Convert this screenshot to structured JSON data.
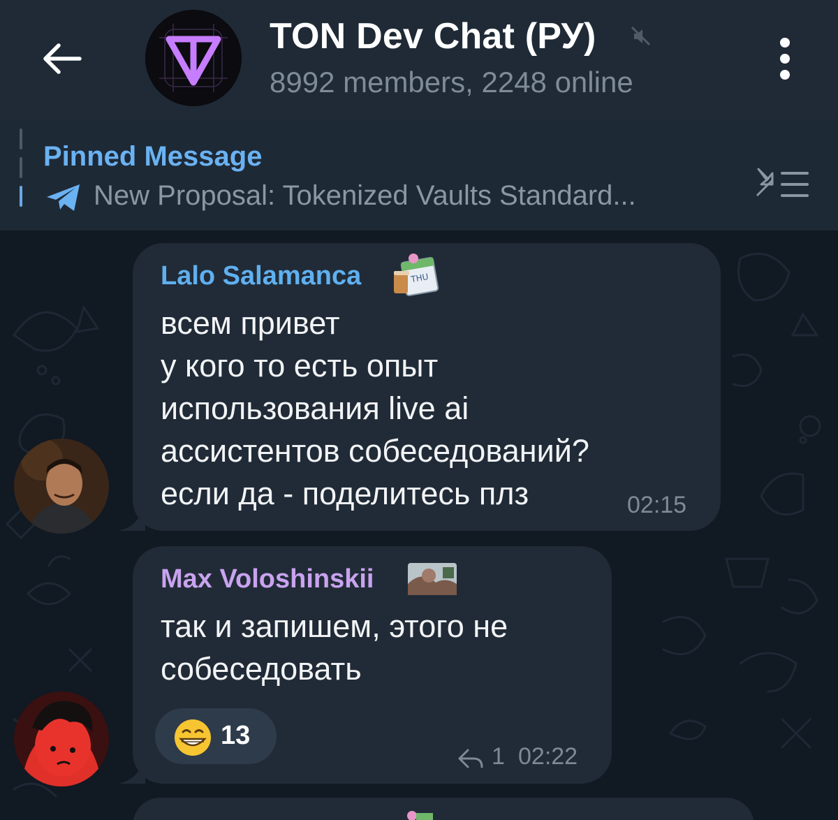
{
  "header": {
    "title": "TON Dev Chat (РУ)",
    "subtitle": "8992 members, 2248 online"
  },
  "pinned": {
    "label": "Pinned Message",
    "text": "New Proposal: Tokenized Vaults Standard..."
  },
  "messages": [
    {
      "sender": "Lalo Salamanca",
      "sender_color": "#5fb0f0",
      "text": "всем привет\nу кого то есть опыт\nиспользования live ai\nассистентов собеседований?\nесли да - поделитесь плз",
      "time": "02:15"
    },
    {
      "sender": "Max Voloshinskii",
      "sender_color": "#c9a3ef",
      "text": "так и запишем, этого не\nсобеседовать",
      "reaction": {
        "emoji": "grinning-face",
        "count": "13"
      },
      "replies": "1",
      "time": "02:22"
    }
  ],
  "colors": {
    "header_bg": "#1f2a36",
    "chat_bg": "#111923",
    "bubble": "#212b37",
    "accent": "#6ab2f2"
  }
}
